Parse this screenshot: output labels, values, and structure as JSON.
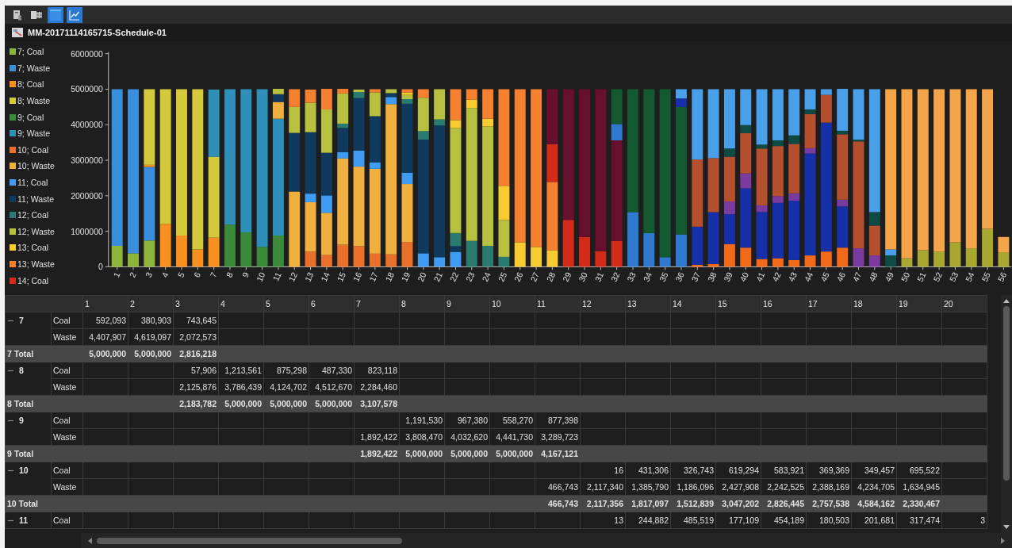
{
  "toolbar": [
    {
      "kind": "report",
      "selected": false
    },
    {
      "kind": "spreadsheet",
      "selected": false
    },
    {
      "kind": "table",
      "selected": true
    },
    {
      "kind": "chart",
      "selected": true
    }
  ],
  "report_title": "MM-20171114165715-Schedule-01",
  "chart": {
    "chart_data": {
      "type": "bar",
      "stacked": true,
      "orientation": "vertical",
      "categories": [
        "1",
        "2",
        "3",
        "4",
        "5",
        "6",
        "7",
        "8",
        "9",
        "10",
        "11",
        "12",
        "13",
        "14",
        "15",
        "16",
        "17",
        "18",
        "19",
        "20",
        "21",
        "22",
        "23",
        "24",
        "25",
        "26",
        "27",
        "28",
        "29",
        "30",
        "31",
        "32",
        "33",
        "34",
        "35",
        "36",
        "37",
        "38",
        "39",
        "40",
        "41",
        "42",
        "43",
        "44",
        "45",
        "46",
        "47",
        "48",
        "49",
        "50",
        "51",
        "52",
        "53",
        "54",
        "55",
        "56"
      ],
      "ylim": [
        0,
        6000000
      ],
      "yticks": [
        0,
        1000000,
        2000000,
        3000000,
        4000000,
        5000000,
        6000000
      ],
      "series": [
        {
          "name": "7; Coal",
          "color": "#8db53c",
          "values": [
            590000,
            380000,
            740000,
            null,
            null,
            null,
            null,
            null,
            null,
            null,
            null,
            null,
            null,
            null,
            null,
            null,
            null,
            null,
            null,
            null,
            null,
            null,
            null,
            null,
            null,
            null,
            null,
            null,
            null,
            null,
            null,
            null,
            null,
            null,
            null,
            null,
            null,
            null,
            null,
            null,
            null,
            null,
            null,
            null,
            null,
            null,
            null,
            null,
            null,
            null,
            null,
            null,
            null,
            null,
            null,
            null
          ]
        },
        {
          "name": "7; Waste",
          "color": "#3a8fdc",
          "values": [
            4410000,
            4620000,
            2070000,
            null,
            null,
            null,
            null,
            null,
            null,
            null,
            null,
            null,
            null,
            null,
            null,
            null,
            null,
            null,
            null,
            null,
            null,
            null,
            null,
            null,
            null,
            null,
            null,
            null,
            null,
            null,
            null,
            null,
            null,
            null,
            null,
            null,
            null,
            null,
            null,
            null,
            null,
            null,
            null,
            null,
            null,
            null,
            null,
            null,
            null,
            null,
            null,
            null,
            null,
            null,
            null,
            null
          ]
        },
        {
          "name": "8; Coal",
          "color": "#f7901e",
          "values": [
            null,
            null,
            60000,
            1210000,
            880000,
            490000,
            820000,
            null,
            null,
            null,
            null,
            null,
            null,
            null,
            null,
            null,
            null,
            null,
            null,
            null,
            null,
            null,
            null,
            null,
            null,
            null,
            null,
            null,
            null,
            null,
            null,
            null,
            null,
            null,
            null,
            null,
            null,
            null,
            null,
            null,
            null,
            null,
            null,
            null,
            null,
            null,
            null,
            null,
            null,
            null,
            null,
            null,
            null,
            null,
            null,
            null
          ]
        },
        {
          "name": "8; Waste",
          "color": "#d4c93a",
          "values": [
            null,
            null,
            2130000,
            3790000,
            4120000,
            4510000,
            2280000,
            null,
            null,
            null,
            null,
            null,
            null,
            null,
            null,
            null,
            null,
            null,
            null,
            null,
            null,
            null,
            null,
            null,
            null,
            null,
            null,
            null,
            null,
            null,
            null,
            null,
            null,
            null,
            null,
            null,
            null,
            null,
            null,
            null,
            null,
            null,
            null,
            null,
            null,
            null,
            null,
            null,
            null,
            null,
            null,
            null,
            null,
            null,
            null,
            null
          ]
        },
        {
          "name": "9; Coal",
          "color": "#3a8a3a",
          "values": [
            null,
            null,
            null,
            null,
            null,
            null,
            null,
            1190000,
            970000,
            560000,
            880000,
            null,
            null,
            null,
            null,
            null,
            null,
            null,
            null,
            null,
            null,
            null,
            null,
            null,
            null,
            null,
            null,
            null,
            null,
            null,
            null,
            null,
            null,
            null,
            null,
            null,
            null,
            null,
            null,
            null,
            null,
            null,
            null,
            null,
            null,
            null,
            null,
            null,
            null,
            null,
            null,
            null,
            null,
            null,
            null,
            null
          ]
        },
        {
          "name": "9; Waste",
          "color": "#2e90b8",
          "values": [
            null,
            null,
            null,
            null,
            null,
            null,
            1890000,
            3810000,
            4030000,
            4440000,
            3290000,
            null,
            null,
            null,
            null,
            null,
            null,
            null,
            null,
            null,
            null,
            null,
            null,
            null,
            null,
            null,
            null,
            null,
            null,
            null,
            null,
            null,
            null,
            null,
            null,
            null,
            null,
            null,
            null,
            null,
            null,
            null,
            null,
            null,
            null,
            null,
            null,
            null,
            null,
            null,
            null,
            null,
            null,
            null,
            null,
            null
          ]
        },
        {
          "name": "10; Coal",
          "color": "#e8702a",
          "values": [
            null,
            null,
            null,
            null,
            null,
            null,
            null,
            null,
            null,
            null,
            null,
            null,
            430000,
            330000,
            620000,
            580000,
            370000,
            350000,
            700000,
            null,
            null,
            null,
            null,
            null,
            null,
            null,
            null,
            null,
            null,
            null,
            null,
            null,
            null,
            null,
            null,
            null,
            null,
            null,
            null,
            null,
            null,
            null,
            null,
            null,
            null,
            null,
            null,
            null,
            null,
            null,
            null,
            null,
            null,
            null,
            null,
            null
          ]
        },
        {
          "name": "10; Waste",
          "color": "#f0b040",
          "values": [
            null,
            null,
            null,
            null,
            null,
            null,
            null,
            null,
            null,
            null,
            470000,
            2120000,
            1390000,
            1190000,
            2430000,
            2240000,
            2390000,
            4230000,
            1630000,
            null,
            null,
            null,
            null,
            null,
            null,
            null,
            null,
            null,
            null,
            null,
            null,
            null,
            null,
            null,
            null,
            null,
            null,
            null,
            null,
            null,
            null,
            null,
            null,
            null,
            null,
            null,
            null,
            null,
            null,
            null,
            null,
            null,
            null,
            null,
            null,
            null
          ]
        },
        {
          "name": "11; Coal",
          "color": "#3f9cf2",
          "values": [
            null,
            null,
            null,
            null,
            null,
            null,
            null,
            null,
            null,
            null,
            null,
            null,
            240000,
            490000,
            180000,
            450000,
            180000,
            200000,
            320000,
            380000,
            270000,
            420000,
            null,
            null,
            null,
            null,
            null,
            null,
            null,
            null,
            null,
            null,
            null,
            null,
            null,
            null,
            null,
            null,
            null,
            null,
            null,
            null,
            null,
            null,
            null,
            null,
            null,
            null,
            null,
            null,
            null,
            null,
            null,
            null,
            null,
            null
          ]
        },
        {
          "name": "11; Waste",
          "color": "#0f3a5e",
          "values": [
            null,
            null,
            null,
            null,
            null,
            null,
            null,
            null,
            null,
            null,
            220000,
            1650000,
            1730000,
            1200000,
            680000,
            1480000,
            1300000,
            110000,
            1940000,
            3200000,
            3710000,
            160000,
            null,
            null,
            null,
            null,
            null,
            null,
            null,
            null,
            null,
            null,
            null,
            null,
            null,
            null,
            null,
            null,
            null,
            null,
            null,
            null,
            null,
            null,
            null,
            null,
            null,
            null,
            null,
            null,
            null,
            null,
            null,
            null,
            null,
            null
          ]
        },
        {
          "name": "12; Coal",
          "color": "#2a7a70",
          "values": [
            null,
            null,
            null,
            null,
            null,
            null,
            null,
            null,
            null,
            null,
            null,
            null,
            null,
            null,
            120000,
            170000,
            null,
            null,
            130000,
            240000,
            170000,
            370000,
            730000,
            590000,
            280000,
            null,
            null,
            null,
            null,
            null,
            null,
            null,
            null,
            null,
            null,
            null,
            null,
            null,
            null,
            null,
            null,
            null,
            null,
            null,
            null,
            null,
            null,
            null,
            null,
            null,
            null,
            null,
            null,
            null,
            null,
            null
          ]
        },
        {
          "name": "12; Waste",
          "color": "#b8c040",
          "values": [
            null,
            null,
            null,
            null,
            null,
            null,
            null,
            null,
            null,
            null,
            150000,
            730000,
            830000,
            1220000,
            850000,
            70000,
            670000,
            110000,
            120000,
            940000,
            850000,
            2960000,
            3740000,
            3360000,
            1040000,
            null,
            null,
            null,
            null,
            null,
            null,
            null,
            null,
            null,
            null,
            null,
            null,
            null,
            null,
            null,
            null,
            null,
            null,
            null,
            null,
            null,
            null,
            null,
            null,
            null,
            null,
            null,
            null,
            null,
            null,
            null
          ]
        },
        {
          "name": "13; Coal",
          "color": "#f8cc30",
          "values": [
            null,
            null,
            null,
            null,
            null,
            null,
            null,
            null,
            null,
            null,
            null,
            null,
            null,
            null,
            null,
            null,
            null,
            null,
            70000,
            null,
            null,
            220000,
            240000,
            220000,
            960000,
            690000,
            560000,
            470000,
            null,
            null,
            null,
            null,
            null,
            null,
            null,
            null,
            null,
            null,
            null,
            null,
            null,
            null,
            null,
            null,
            null,
            null,
            null,
            null,
            null,
            null,
            null,
            null,
            null,
            null,
            null,
            null
          ]
        },
        {
          "name": "13; Waste",
          "color": "#f48030",
          "values": [
            null,
            null,
            null,
            null,
            null,
            null,
            null,
            null,
            null,
            null,
            null,
            500000,
            370000,
            580000,
            130000,
            null,
            90000,
            null,
            90000,
            240000,
            null,
            870000,
            290000,
            830000,
            2720000,
            4310000,
            4440000,
            1920000,
            null,
            null,
            null,
            null,
            null,
            null,
            null,
            null,
            null,
            null,
            null,
            null,
            null,
            null,
            null,
            null,
            null,
            null,
            null,
            null,
            null,
            null,
            null,
            null,
            null,
            null,
            null,
            null
          ]
        },
        {
          "name": "14; Coal",
          "color": "#d42a1a",
          "values": [
            null,
            null,
            null,
            null,
            null,
            null,
            null,
            null,
            null,
            null,
            null,
            null,
            null,
            null,
            null,
            null,
            null,
            null,
            null,
            null,
            null,
            null,
            null,
            null,
            null,
            null,
            null,
            1060000,
            1320000,
            840000,
            440000,
            730000,
            null,
            null,
            null,
            null,
            null,
            null,
            null,
            null,
            null,
            null,
            null,
            null,
            null,
            null,
            null,
            null,
            null,
            null,
            null,
            null,
            null,
            null,
            null,
            null
          ]
        },
        {
          "color": "#66102e",
          "values": [
            null,
            null,
            null,
            null,
            null,
            null,
            null,
            null,
            null,
            null,
            null,
            null,
            null,
            null,
            null,
            null,
            null,
            null,
            null,
            null,
            null,
            null,
            null,
            null,
            null,
            null,
            null,
            1550000,
            3680000,
            4160000,
            4560000,
            2830000,
            null,
            null,
            null,
            null,
            null,
            null,
            null,
            null,
            null,
            null,
            null,
            null,
            null,
            null,
            null,
            null,
            null,
            null,
            null,
            null,
            null,
            null,
            null,
            null
          ]
        },
        {
          "color": "#2f7ad0",
          "values": [
            null,
            null,
            null,
            null,
            null,
            null,
            null,
            null,
            null,
            null,
            null,
            null,
            null,
            null,
            null,
            null,
            null,
            null,
            null,
            null,
            null,
            null,
            null,
            null,
            null,
            null,
            null,
            null,
            null,
            null,
            null,
            460000,
            1540000,
            950000,
            270000,
            910000,
            null,
            null,
            null,
            null,
            null,
            null,
            null,
            null,
            null,
            null,
            null,
            null,
            null,
            null,
            null,
            null,
            null,
            null,
            null,
            null
          ]
        },
        {
          "color": "#145a30",
          "values": [
            null,
            null,
            null,
            null,
            null,
            null,
            null,
            null,
            null,
            null,
            null,
            null,
            null,
            null,
            null,
            null,
            null,
            null,
            null,
            null,
            null,
            null,
            null,
            null,
            null,
            null,
            null,
            null,
            null,
            null,
            null,
            980000,
            3460000,
            4050000,
            4730000,
            3590000,
            null,
            null,
            null,
            null,
            null,
            null,
            null,
            null,
            null,
            null,
            null,
            null,
            null,
            null,
            null,
            null,
            null,
            null,
            null,
            null
          ]
        },
        {
          "color": "#f06a1a",
          "values": [
            null,
            null,
            null,
            null,
            null,
            null,
            null,
            null,
            null,
            null,
            null,
            null,
            null,
            null,
            null,
            null,
            null,
            null,
            null,
            null,
            null,
            null,
            null,
            null,
            null,
            null,
            null,
            null,
            null,
            null,
            null,
            null,
            null,
            null,
            null,
            null,
            60000,
            80000,
            640000,
            540000,
            220000,
            240000,
            190000,
            320000,
            430000,
            540000,
            null,
            null,
            null,
            null,
            null,
            null,
            null,
            null,
            null,
            null
          ]
        },
        {
          "color": "#1530a8",
          "values": [
            null,
            null,
            null,
            null,
            null,
            null,
            null,
            null,
            null,
            null,
            null,
            null,
            null,
            null,
            null,
            null,
            null,
            null,
            null,
            null,
            null,
            null,
            null,
            null,
            null,
            null,
            null,
            null,
            null,
            null,
            null,
            null,
            null,
            null,
            null,
            240000,
            1070000,
            1460000,
            840000,
            1670000,
            1320000,
            1560000,
            1670000,
            2870000,
            3630000,
            1160000,
            null,
            null,
            null,
            null,
            null,
            null,
            null,
            null,
            null,
            null
          ]
        },
        {
          "color": "#7a3aa0",
          "values": [
            null,
            null,
            null,
            null,
            null,
            null,
            null,
            null,
            null,
            null,
            null,
            null,
            null,
            null,
            null,
            null,
            null,
            null,
            null,
            null,
            null,
            null,
            null,
            null,
            null,
            null,
            null,
            null,
            null,
            null,
            null,
            null,
            null,
            null,
            null,
            null,
            null,
            null,
            360000,
            420000,
            190000,
            190000,
            210000,
            150000,
            null,
            190000,
            520000,
            320000,
            null,
            null,
            null,
            null,
            null,
            null,
            null,
            null
          ]
        },
        {
          "color": "#b4502e",
          "values": [
            null,
            null,
            null,
            null,
            null,
            null,
            null,
            null,
            null,
            null,
            null,
            null,
            null,
            null,
            null,
            null,
            null,
            null,
            null,
            null,
            null,
            null,
            null,
            null,
            null,
            null,
            null,
            null,
            null,
            null,
            null,
            null,
            null,
            null,
            null,
            null,
            1890000,
            1520000,
            1260000,
            1130000,
            1600000,
            1410000,
            1390000,
            960000,
            780000,
            1840000,
            3010000,
            840000,
            null,
            null,
            null,
            null,
            null,
            null,
            null,
            null
          ]
        },
        {
          "color": "#0e4a44",
          "values": [
            null,
            null,
            null,
            null,
            null,
            null,
            null,
            null,
            null,
            null,
            null,
            null,
            null,
            null,
            null,
            null,
            null,
            null,
            null,
            null,
            null,
            null,
            null,
            null,
            null,
            null,
            null,
            null,
            null,
            null,
            null,
            null,
            null,
            null,
            null,
            null,
            null,
            null,
            230000,
            230000,
            110000,
            160000,
            240000,
            130000,
            null,
            100000,
            50000,
            380000,
            320000,
            null,
            null,
            null,
            null,
            null,
            null,
            null
          ]
        },
        {
          "color": "#4aa0e8",
          "values": [
            null,
            null,
            null,
            null,
            null,
            null,
            null,
            null,
            null,
            null,
            null,
            null,
            null,
            null,
            null,
            null,
            null,
            null,
            null,
            null,
            null,
            null,
            null,
            null,
            null,
            null,
            null,
            null,
            null,
            null,
            null,
            null,
            null,
            null,
            null,
            260000,
            1980000,
            1940000,
            1670000,
            1010000,
            1560000,
            1440000,
            1300000,
            570000,
            160000,
            1180000,
            1420000,
            3460000,
            170000,
            null,
            null,
            null,
            null,
            null,
            null,
            null
          ]
        },
        {
          "color": "#a8a830",
          "values": [
            null,
            null,
            null,
            null,
            null,
            null,
            null,
            null,
            null,
            null,
            null,
            null,
            null,
            null,
            null,
            null,
            null,
            null,
            null,
            null,
            null,
            null,
            null,
            null,
            null,
            null,
            null,
            null,
            null,
            null,
            null,
            null,
            null,
            null,
            null,
            null,
            null,
            null,
            null,
            null,
            null,
            null,
            null,
            null,
            null,
            null,
            null,
            null,
            null,
            240000,
            470000,
            430000,
            690000,
            520000,
            1070000,
            410000
          ]
        },
        {
          "color": "#f4a54a",
          "values": [
            null,
            null,
            null,
            null,
            null,
            null,
            null,
            null,
            null,
            null,
            null,
            null,
            null,
            null,
            null,
            null,
            null,
            null,
            null,
            null,
            null,
            null,
            null,
            null,
            null,
            null,
            null,
            null,
            null,
            null,
            null,
            null,
            null,
            null,
            null,
            null,
            null,
            null,
            null,
            null,
            null,
            null,
            null,
            null,
            null,
            null,
            null,
            null,
            4510000,
            4760000,
            4530000,
            4570000,
            4310000,
            4480000,
            3930000,
            430000
          ]
        }
      ]
    }
  },
  "table": {
    "columns": [
      "1",
      "2",
      "3",
      "4",
      "5",
      "6",
      "7",
      "8",
      "9",
      "10",
      "11",
      "12",
      "13",
      "14",
      "15",
      "16",
      "17",
      "18",
      "19",
      "20"
    ],
    "groups": [
      {
        "label": "7",
        "expanded": true,
        "rows": [
          {
            "label": "Coal",
            "cells": [
              "592,093",
              "380,903",
              "743,645",
              null,
              null,
              null,
              null,
              null,
              null,
              null,
              null,
              null,
              null,
              null,
              null,
              null,
              null,
              null,
              null,
              null
            ]
          },
          {
            "label": "Waste",
            "cells": [
              "4,407,907",
              "4,619,097",
              "2,072,573",
              null,
              null,
              null,
              null,
              null,
              null,
              null,
              null,
              null,
              null,
              null,
              null,
              null,
              null,
              null,
              null,
              null
            ]
          }
        ],
        "total": {
          "label": "7 Total",
          "cells": [
            "5,000,000",
            "5,000,000",
            "2,816,218",
            null,
            null,
            null,
            null,
            null,
            null,
            null,
            null,
            null,
            null,
            null,
            null,
            null,
            null,
            null,
            null,
            null
          ]
        }
      },
      {
        "label": "8",
        "expanded": true,
        "rows": [
          {
            "label": "Coal",
            "cells": [
              null,
              null,
              "57,906",
              "1,213,561",
              "875,298",
              "487,330",
              "823,118",
              null,
              null,
              null,
              null,
              null,
              null,
              null,
              null,
              null,
              null,
              null,
              null,
              null
            ]
          },
          {
            "label": "Waste",
            "cells": [
              null,
              null,
              "2,125,876",
              "3,786,439",
              "4,124,702",
              "4,512,670",
              "2,284,460",
              null,
              null,
              null,
              null,
              null,
              null,
              null,
              null,
              null,
              null,
              null,
              null,
              null
            ]
          }
        ],
        "total": {
          "label": "8 Total",
          "cells": [
            null,
            null,
            "2,183,782",
            "5,000,000",
            "5,000,000",
            "5,000,000",
            "3,107,578",
            null,
            null,
            null,
            null,
            null,
            null,
            null,
            null,
            null,
            null,
            null,
            null,
            null
          ]
        }
      },
      {
        "label": "9",
        "expanded": true,
        "rows": [
          {
            "label": "Coal",
            "cells": [
              null,
              null,
              null,
              null,
              null,
              null,
              null,
              "1,191,530",
              "967,380",
              "558,270",
              "877,398",
              null,
              null,
              null,
              null,
              null,
              null,
              null,
              null,
              null
            ]
          },
          {
            "label": "Waste",
            "cells": [
              null,
              null,
              null,
              null,
              null,
              null,
              "1,892,422",
              "3,808,470",
              "4,032,620",
              "4,441,730",
              "3,289,723",
              null,
              null,
              null,
              null,
              null,
              null,
              null,
              null,
              null
            ]
          }
        ],
        "total": {
          "label": "9 Total",
          "cells": [
            null,
            null,
            null,
            null,
            null,
            null,
            "1,892,422",
            "5,000,000",
            "5,000,000",
            "5,000,000",
            "4,167,121",
            null,
            null,
            null,
            null,
            null,
            null,
            null,
            null,
            null
          ]
        }
      },
      {
        "label": "10",
        "expanded": true,
        "rows": [
          {
            "label": "Coal",
            "cells": [
              null,
              null,
              null,
              null,
              null,
              null,
              null,
              null,
              null,
              null,
              null,
              "16",
              "431,306",
              "326,743",
              "619,294",
              "583,921",
              "369,369",
              "349,457",
              "695,522",
              null
            ]
          },
          {
            "label": "Waste",
            "cells": [
              null,
              null,
              null,
              null,
              null,
              null,
              null,
              null,
              null,
              null,
              "466,743",
              "2,117,340",
              "1,385,790",
              "1,186,096",
              "2,427,908",
              "2,242,525",
              "2,388,169",
              "4,234,705",
              "1,634,945",
              null
            ]
          }
        ],
        "total": {
          "label": "10 Total",
          "cells": [
            null,
            null,
            null,
            null,
            null,
            null,
            null,
            null,
            null,
            null,
            "466,743",
            "2,117,356",
            "1,817,097",
            "1,512,839",
            "3,047,202",
            "2,826,445",
            "2,757,538",
            "4,584,162",
            "2,330,467",
            null
          ]
        }
      },
      {
        "label": "11",
        "expanded": true,
        "rows": [
          {
            "label": "Coal",
            "cells": [
              null,
              null,
              null,
              null,
              null,
              null,
              null,
              null,
              null,
              null,
              null,
              "13",
              "244,882",
              "485,519",
              "177,109",
              "454,189",
              "180,503",
              "201,681",
              "317,474",
              "3"
            ]
          }
        ]
      }
    ]
  }
}
